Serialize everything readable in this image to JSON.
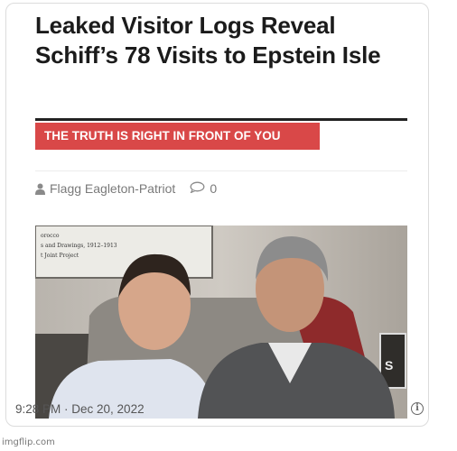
{
  "article": {
    "headline": "Leaked Visitor Logs Reveal Schiff’s 78 Visits to Epstein Isle",
    "tagline": "THE TRUTH IS RIGHT IN FRONT OF YOU",
    "author": "Flagg Eagleton-Patriot",
    "comment_count": "0",
    "photo_sign_lines": [
      "orocco",
      "s and Drawings, 1912–1913",
      "t Joint Project"
    ],
    "photo_frame_letter": "S"
  },
  "tweet": {
    "timestamp": "9:28 PM · Dec 20, 2022",
    "info_symbol": "i"
  },
  "watermark": "imgflip.com",
  "colors": {
    "tagline_bg": "#d94848",
    "headline_text": "#1b1b1b",
    "meta_text": "#7a7a7a"
  },
  "icons": {
    "author": "person-icon",
    "comments": "speech-bubble-icon",
    "info": "info-icon"
  }
}
